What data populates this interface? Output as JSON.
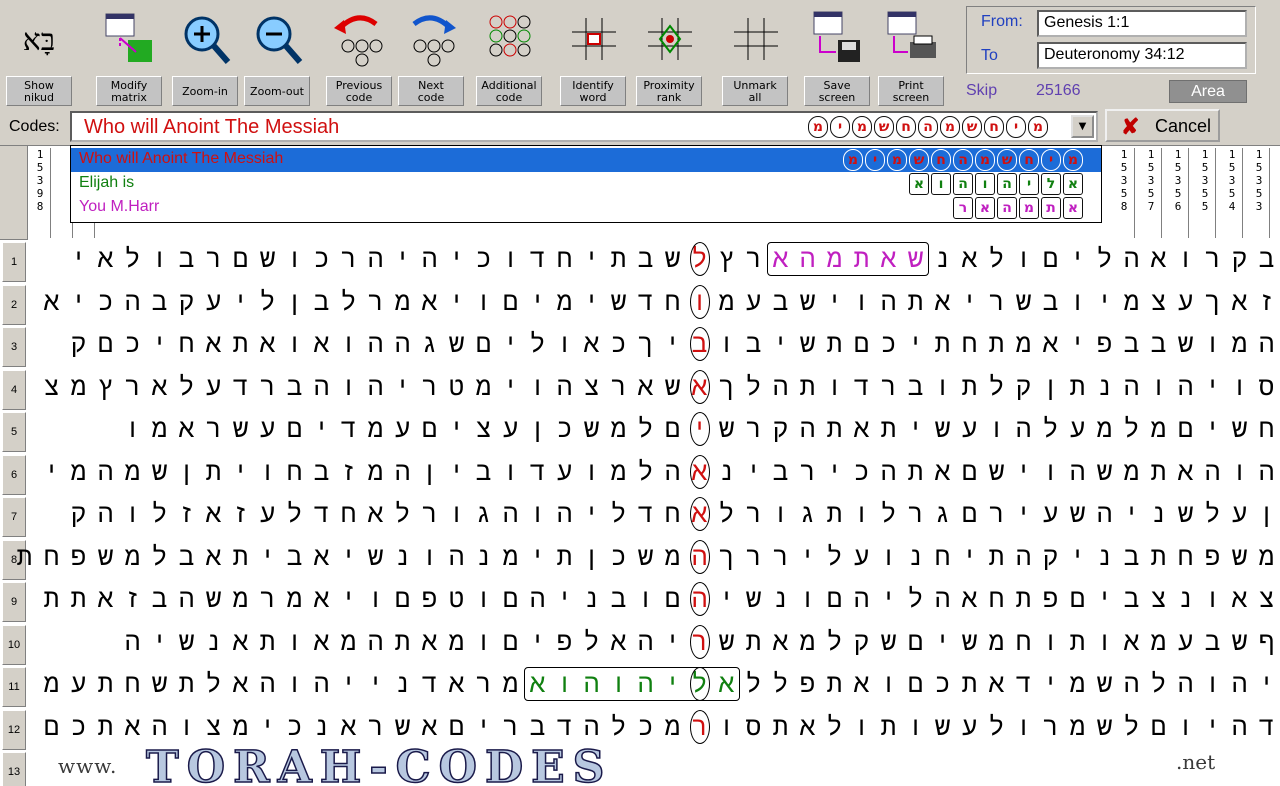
{
  "toolbar": {
    "buttons": [
      {
        "label": "Show\nnikud",
        "icon": "hebrew-letters-icon"
      },
      {
        "label": "Modify\nmatrix",
        "icon": "modify-matrix-icon"
      },
      {
        "label": "Zoom-in",
        "icon": "zoom-in-icon"
      },
      {
        "label": "Zoom-out",
        "icon": "zoom-out-icon"
      },
      {
        "label": "Previous\ncode",
        "icon": "previous-code-icon"
      },
      {
        "label": "Next\ncode",
        "icon": "next-code-icon"
      },
      {
        "label": "Additional\ncode",
        "icon": "additional-code-icon"
      },
      {
        "label": "Identify\nword",
        "icon": "identify-word-icon"
      },
      {
        "label": "Proximity\nrank",
        "icon": "proximity-rank-icon"
      },
      {
        "label": "Unmark\nall",
        "icon": "unmark-all-icon"
      },
      {
        "label": "Save\nscreen",
        "icon": "save-screen-icon"
      },
      {
        "label": "Print\nscreen",
        "icon": "print-screen-icon"
      }
    ],
    "show_nikud_glyph": "בָּא"
  },
  "range": {
    "from_label": "From:",
    "from_value": "Genesis 1:1",
    "to_label": "To",
    "to_value": "Deuteronomy 34:12"
  },
  "skip": {
    "label": "Skip",
    "value": "25166"
  },
  "area_label": "Area",
  "codes": {
    "label": "Codes:",
    "current": "Who will Anoint The Messiah",
    "current_letters": [
      "מ",
      "י",
      "ח",
      "ש",
      "מ",
      "ה",
      "ח",
      "ש",
      "מ",
      "י",
      "מ"
    ],
    "items": [
      {
        "label": "Who will Anoint The Messiah",
        "color": "#d01010",
        "letters": [
          "מ",
          "י",
          "ח",
          "ש",
          "מ",
          "ה",
          "ח",
          "ש",
          "מ",
          "י",
          "מ"
        ]
      },
      {
        "label": "Elijah is",
        "color": "#108010",
        "letters": [
          "א",
          "ל",
          "י",
          "ה",
          "ו",
          "ה",
          "ו",
          "א"
        ]
      },
      {
        "label": "You M.Harr",
        "color": "#c020c0",
        "letters": [
          "א",
          "ת",
          "מ",
          "ה",
          "א",
          "ר"
        ]
      }
    ]
  },
  "cancel_label": "Cancel",
  "columns": {
    "left": [
      "1\n5\n3\n9\n8"
    ],
    "right": [
      "1\n5\n3\n5\n8",
      "1\n5\n3\n5\n7",
      "1\n5\n3\n5\n6",
      "1\n5\n3\n5\n5",
      "1\n5\n3\n5\n4",
      "1\n5\n3\n5\n3"
    ]
  },
  "rows": [
    {
      "num": "1",
      "letters": "בקרואהליםולאנשאתמהארץלשבתיחדוכיהיהרכושםרבולאי"
    },
    {
      "num": "2",
      "letters": "זאךעצמיובשריאתהוישבעמוחדשימיםויאמרלבןליעקבהכיא"
    },
    {
      "num": "3",
      "letters": "המושבבפיאמתחתיכםתשיבוביךכאוליםשגההואואתאחיכםק"
    },
    {
      "num": "4",
      "letters": "סויהוהנתןקלתוברדותהלךאשארצהוימטריהוהברדעלארץמצ"
    },
    {
      "num": "5",
      "letters": "חשיםמלמעלהועשיתאתהקרשיםלמשכןעציםעמדיםעשראמו"
    },
    {
      "num": "6",
      "letters": "הוהאתמשהוישםאתהכירבינאהלמועדוביןהמזבחויתןשמהמי"
    },
    {
      "num": "7",
      "letters": "ןעלשניהשעירםגרלותגורלאחדליהוהגורלאחדלעזאזלוהק"
    },
    {
      "num": "8",
      "letters": "משפחתבניקהתיחנועליררךהמשכןתימנהונשיאביתאבלמשפחת"
    },
    {
      "num": "9",
      "letters": "צאונצביםפתחאהליהםונשיהםובניהםוטפםויאמרמשהבזאתת"
    },
    {
      "num": "10",
      "letters": "ףשבעמאותוחמשיםשקלמאתשריהאלפיםומאתהמאותאנשיה"
    },
    {
      "num": "11",
      "letters": "יהוהלהשמידאתכםואתפללאליהוהואמראדנייהוהאלתשחתעמ"
    },
    {
      "num": "12",
      "letters": "דהיוםלשמרולעשותולאתסורמכלהדבריםאשראנכימצוהאתכם"
    },
    {
      "num": "13",
      "letters": ""
    }
  ],
  "logo": {
    "www": "www.",
    "main": "TORAH-CODES",
    "net": ".net"
  },
  "colors": {
    "red": "#d01010",
    "green": "#108010",
    "magenta": "#c020c0",
    "selection": "#1c6cd8",
    "accent": "#6040b0"
  }
}
